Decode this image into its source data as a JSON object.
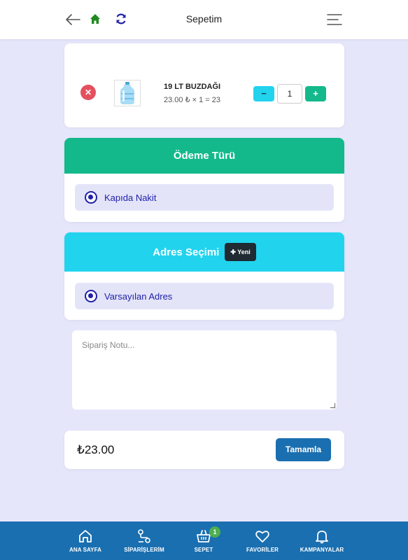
{
  "header": {
    "title": "Sepetim",
    "icons": {
      "back": "arrow-left-icon",
      "home": "home-icon",
      "refresh": "refresh-icon",
      "menu": "menu-icon"
    },
    "colors": {
      "home": "#1f8a1f",
      "refresh": "#1f21a8"
    }
  },
  "cart": {
    "items": [
      {
        "name": "19 LT BUZDAĞI",
        "price_line": "23.00 ₺ × 1 = 23",
        "quantity": "1",
        "minus": "−",
        "plus": "+",
        "remove": "✕"
      }
    ]
  },
  "payment": {
    "title": "Ödeme Türü",
    "selected": "Kapıda Nakit",
    "color": "#13b98b"
  },
  "address": {
    "title": "Adres Seçimi",
    "new_label": "✚ Yeni",
    "selected": "Varsayılan Adres",
    "color": "#22d3ee"
  },
  "note": {
    "placeholder": "Sipariş Notu..."
  },
  "summary": {
    "total": "₺23.00",
    "finish_label": "Tamamla"
  },
  "bottom_nav": {
    "color": "#1a6fb0",
    "items": [
      {
        "label": "ANA SAYFA",
        "icon": "home-icon"
      },
      {
        "label": "SİPARİŞLERİM",
        "icon": "orders-icon"
      },
      {
        "label": "SEPET",
        "icon": "basket-icon",
        "badge": "1"
      },
      {
        "label": "FAVORİLER",
        "icon": "heart-icon"
      },
      {
        "label": "KAMPANYALAR",
        "icon": "bell-icon"
      }
    ]
  },
  "theme": {
    "background": "#e6e6fb",
    "remove": "#e4505e",
    "radio": "#1f21a8"
  }
}
